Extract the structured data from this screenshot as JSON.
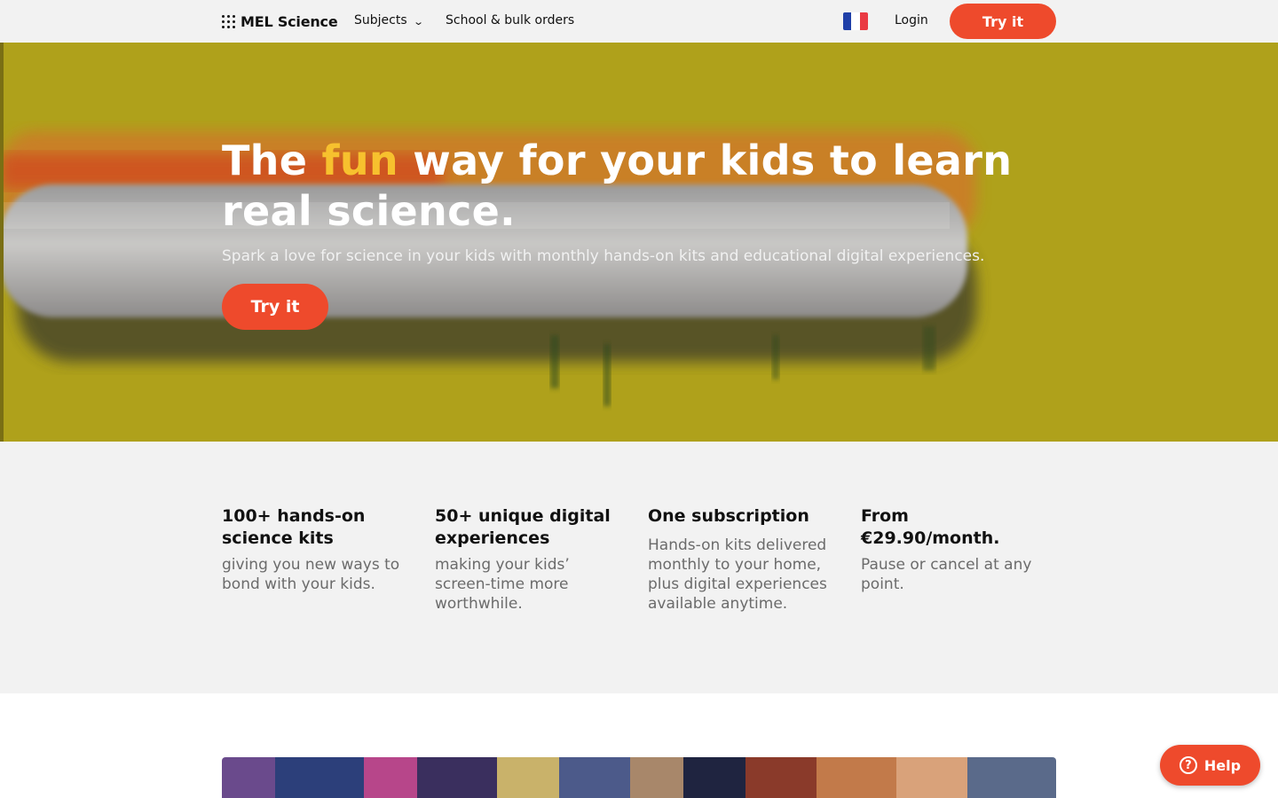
{
  "header": {
    "logo_text": "MEL Science",
    "nav": {
      "subjects_label": "Subjects",
      "school_label": "School & bulk orders"
    },
    "language_flag_icon": "france-flag-icon",
    "login_label": "Login",
    "try_label": "Try it"
  },
  "hero": {
    "title_before": "The ",
    "title_highlight": "fun",
    "title_after": " way for your kids to learn real science.",
    "subtitle": "Spark a love for science in your kids with monthly hands-on kits and educational digital experiences.",
    "cta_label": "Try it"
  },
  "features": [
    {
      "title": "100+ hands-on science kits",
      "text": "giving you new ways to bond with your kids."
    },
    {
      "title": "50+ unique digital experiences",
      "text": "making your kids’ screen-time more worthwhile."
    },
    {
      "title": "One subscription",
      "text": "Hands-on kits delivered monthly to your home, plus digital experiences available anytime."
    },
    {
      "title": "From €29.90/month.",
      "text": "Pause or cancel at any point."
    }
  ],
  "help": {
    "label": "Help"
  },
  "colors": {
    "accent": "#ee4a2c",
    "highlight": "#f7c12e",
    "hero_bg": "#b0a21c",
    "features_bg": "#f2f2f2"
  }
}
